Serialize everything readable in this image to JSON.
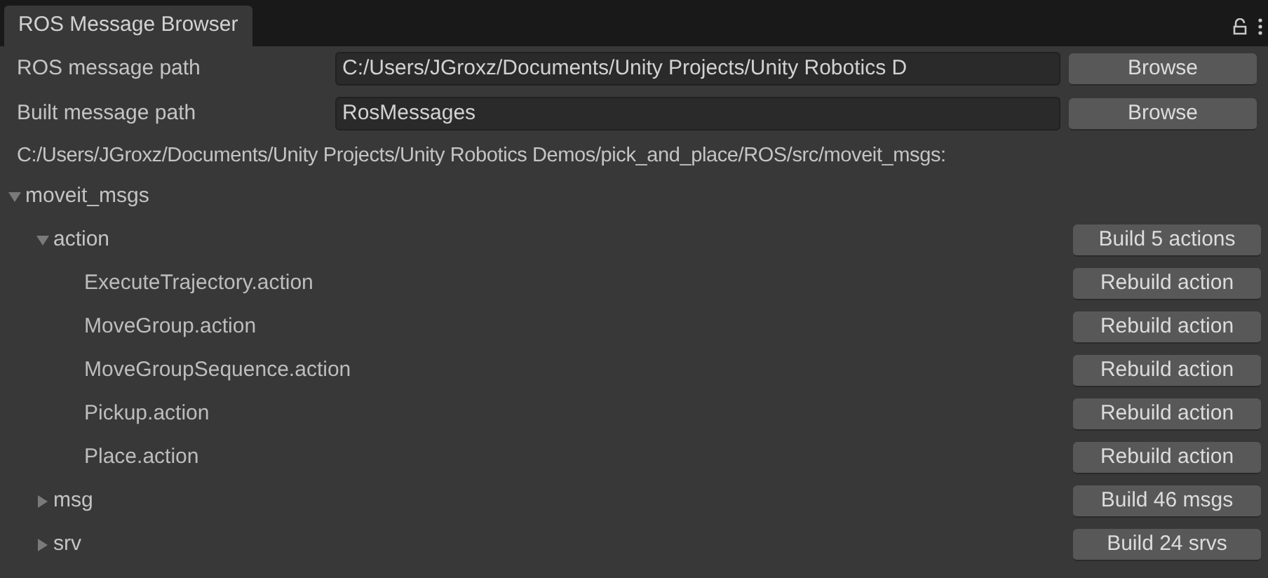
{
  "tab": {
    "title": "ROS Message Browser",
    "selected": true
  },
  "fields": [
    {
      "label": "ROS message path",
      "value": "C:/Users/JGroxz/Documents/Unity Projects/Unity Robotics D",
      "button": "Browse"
    },
    {
      "label": "Built message path",
      "value": "RosMessages",
      "button": "Browse"
    }
  ],
  "full_path": "C:/Users/JGroxz/Documents/Unity Projects/Unity Robotics Demos/pick_and_place/ROS/src/moveit_msgs:",
  "tree": [
    {
      "label": "moveit_msgs",
      "kind": "folder",
      "expanded": true,
      "children": [
        {
          "label": "action",
          "kind": "folder",
          "expanded": true,
          "button": "Build 5 actions",
          "children": [
            {
              "label": "ExecuteTrajectory.action",
              "kind": "file",
              "button": "Rebuild action"
            },
            {
              "label": "MoveGroup.action",
              "kind": "file",
              "button": "Rebuild action"
            },
            {
              "label": "MoveGroupSequence.action",
              "kind": "file",
              "button": "Rebuild action"
            },
            {
              "label": "Pickup.action",
              "kind": "file",
              "button": "Rebuild action"
            },
            {
              "label": "Place.action",
              "kind": "file",
              "button": "Rebuild action"
            }
          ]
        },
        {
          "label": "msg",
          "kind": "folder",
          "expanded": false,
          "button": "Build 46 msgs"
        },
        {
          "label": "srv",
          "kind": "folder",
          "expanded": false,
          "button": "Build 24 srvs"
        }
      ]
    }
  ]
}
